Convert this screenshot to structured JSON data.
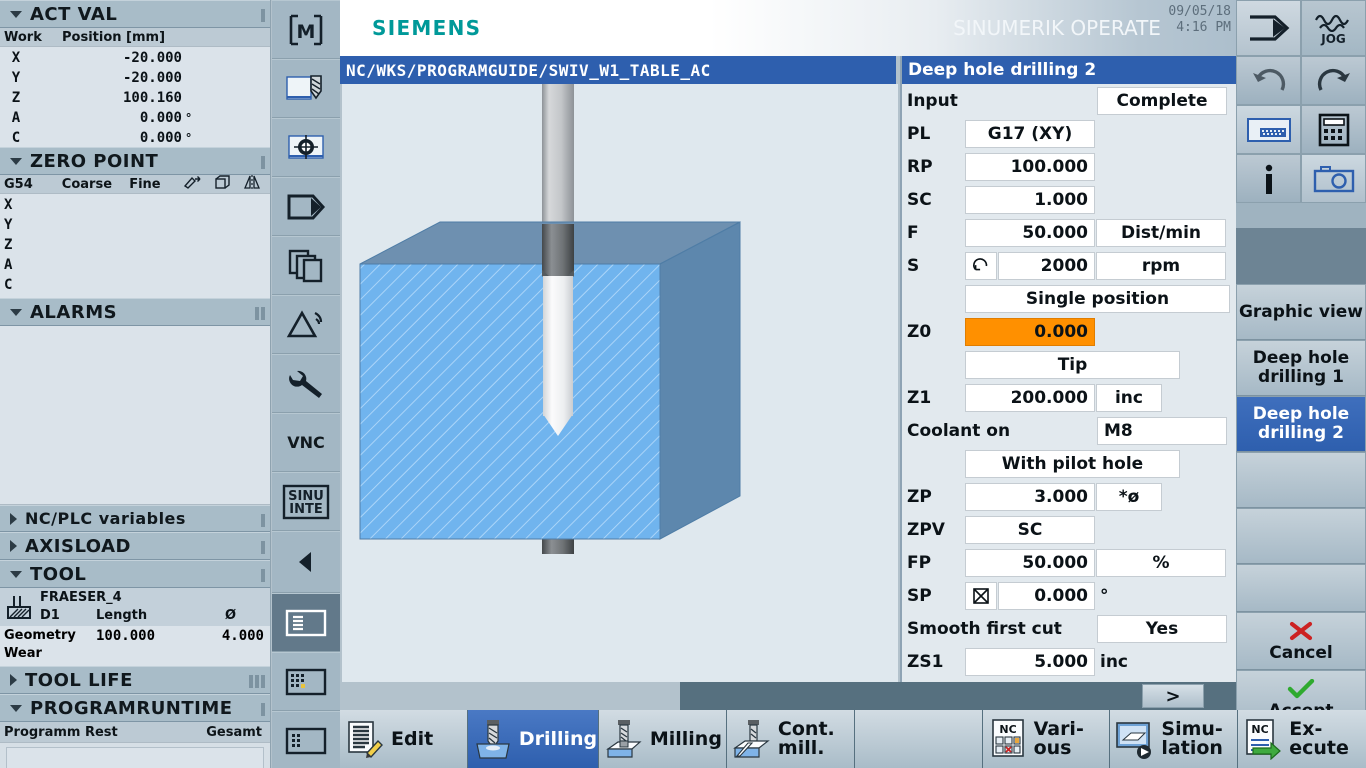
{
  "header": {
    "brand": "SIEMENS",
    "product": "SINUMERIK OPERATE",
    "date": "09/05/18",
    "time": "4:16 PM",
    "mode_label": "JOG",
    "path": "NC/WKS/PROGRAMGUIDE/SWIV_W1_TABLE_AC"
  },
  "left_panels": {
    "act_val": {
      "title": "ACT VAL",
      "col_work": "Work",
      "col_position": "Position [mm]",
      "axes": [
        {
          "name": "X",
          "value": "-20.000",
          "unit": ""
        },
        {
          "name": "Y",
          "value": "-20.000",
          "unit": ""
        },
        {
          "name": "Z",
          "value": "100.160",
          "unit": ""
        },
        {
          "name": "A",
          "value": "0.000",
          "unit": "°"
        },
        {
          "name": "C",
          "value": "0.000",
          "unit": "°"
        }
      ]
    },
    "zero_point": {
      "title": "ZERO POINT",
      "col_g54": "G54",
      "col_coarse": "Coarse",
      "col_fine": "Fine",
      "axes": [
        "X",
        "Y",
        "Z",
        "A",
        "C"
      ]
    },
    "alarms": {
      "title": "ALARMS"
    },
    "nc_plc": {
      "title": "NC/PLC variables"
    },
    "axisload": {
      "title": "AXISLOAD"
    },
    "tool": {
      "title": "TOOL",
      "tool_name": "FRAESER_4",
      "edge": "D1",
      "col_length": "Length",
      "col_dia": "Ø",
      "row_geometry": "Geometry",
      "geometry_length": "100.000",
      "geometry_dia": "4.000",
      "row_wear": "Wear"
    },
    "tool_life": {
      "title": "TOOL LIFE"
    },
    "program_runtime": {
      "title": "PROGRAMRUNTIME",
      "label_rest": "Programm Rest",
      "label_total": "Gesamt"
    }
  },
  "icon_strip": [
    {
      "name": "machine-icon",
      "glyph": "M"
    },
    {
      "name": "program-tool-icon",
      "glyph": ""
    },
    {
      "name": "program-position-icon",
      "glyph": ""
    },
    {
      "name": "program-manager-icon",
      "glyph": ""
    },
    {
      "name": "copy-pages-icon",
      "glyph": ""
    },
    {
      "name": "alarm-icon",
      "glyph": ""
    },
    {
      "name": "wrench-setup-icon",
      "glyph": ""
    },
    {
      "name": "vnc-icon",
      "glyph": "VNC"
    },
    {
      "name": "sinumerik-integrate-icon",
      "glyph": "SINU INTE"
    },
    {
      "name": "back-arrow-icon",
      "glyph": "◀"
    },
    {
      "name": "screen-list-icon",
      "glyph": ""
    },
    {
      "name": "keyboard-panel-icon",
      "glyph": ""
    },
    {
      "name": "grid-panel-icon",
      "glyph": ""
    }
  ],
  "param_panel": {
    "title": "Deep hole drilling 2",
    "rows": [
      {
        "label": "Input",
        "value": "",
        "value2": "Complete",
        "unit": "",
        "kind": "label_right"
      },
      {
        "label": "PL",
        "value": "G17 (XY)",
        "value2": "",
        "unit": "",
        "kind": "center"
      },
      {
        "label": "RP",
        "value": "100.000",
        "value2": "",
        "unit": "",
        "kind": "num"
      },
      {
        "label": "SC",
        "value": "1.000",
        "value2": "",
        "unit": "",
        "kind": "num"
      },
      {
        "label": "F",
        "value": "50.000",
        "value2": "",
        "unit": "Dist/min",
        "kind": "num_unitbox"
      },
      {
        "label": "S",
        "value": "2000",
        "value2": "",
        "unit": "rpm",
        "kind": "spindle"
      },
      {
        "label": "",
        "value": "Single position",
        "value2": "",
        "unit": "",
        "kind": "wide"
      },
      {
        "label": "Z0",
        "value": "0.000",
        "value2": "",
        "unit": "",
        "kind": "num_selected"
      },
      {
        "label": "",
        "value": "Tip",
        "value2": "",
        "unit": "",
        "kind": "wide"
      },
      {
        "label": "Z1",
        "value": "200.000",
        "value2": "",
        "unit": "inc",
        "kind": "num_unitbox"
      },
      {
        "label": "Coolant on",
        "value": "",
        "value2": "M8",
        "unit": "",
        "kind": "label_right_left"
      },
      {
        "label": "",
        "value": "With pilot hole",
        "value2": "",
        "unit": "",
        "kind": "wide"
      },
      {
        "label": "ZP",
        "value": "3.000",
        "value2": "",
        "unit": "*ø",
        "kind": "num_unitbox"
      },
      {
        "label": "ZPV",
        "value": "SC",
        "value2": "",
        "unit": "",
        "kind": "center"
      },
      {
        "label": "FP",
        "value": "50.000",
        "value2": "",
        "unit": "%",
        "kind": "num_unitbox"
      },
      {
        "label": "SP",
        "value": "0.000",
        "value2": "",
        "unit": "°",
        "kind": "checkbox_num"
      },
      {
        "label": "Smooth first cut",
        "value": "",
        "value2": "Yes",
        "unit": "",
        "kind": "label_right"
      },
      {
        "label": "ZS1",
        "value": "5.000",
        "value2": "",
        "unit": "inc",
        "kind": "num_plainunit"
      }
    ]
  },
  "right_column": {
    "mode_button": "JOG",
    "icon_buttons": [
      {
        "name": "undo-icon"
      },
      {
        "name": "redo-icon"
      },
      {
        "name": "keyboard-icon"
      },
      {
        "name": "calculator-icon"
      },
      {
        "name": "info-icon"
      },
      {
        "name": "camera-icon"
      }
    ],
    "softkeys": [
      {
        "label": "Graphic view",
        "active": false
      },
      {
        "label": "Deep hole drilling 1",
        "active": false
      },
      {
        "label": "Deep hole drilling 2",
        "active": true
      },
      {
        "label": "",
        "active": false
      },
      {
        "label": "",
        "active": false
      },
      {
        "label": "",
        "active": false
      }
    ],
    "cancel_label": "Cancel",
    "accept_label": "Accept",
    "forward_label": ">"
  },
  "bottom_bar": {
    "keys": [
      {
        "label": "Edit",
        "icon": "edit-icon",
        "active": false
      },
      {
        "label": "Drilling",
        "icon": "drilling-icon",
        "active": true
      },
      {
        "label": "Milling",
        "icon": "milling-icon",
        "active": false
      },
      {
        "label": "Cont. mill.",
        "icon": "contour-mill-icon",
        "active": false
      },
      {
        "label": "",
        "icon": "",
        "active": false
      },
      {
        "label": "Vari- ous",
        "icon": "various-nc-icon",
        "active": false
      },
      {
        "label": "Simu- lation",
        "icon": "simulation-icon",
        "active": false
      },
      {
        "label": "Ex- ecute",
        "icon": "execute-nc-icon",
        "active": false
      }
    ]
  },
  "colors": {
    "accent_blue": "#2e5fae",
    "selected_orange": "#ff9000",
    "siemens_teal": "#009999",
    "panel_bg": "#dbe3ea",
    "header_bg": "#a8bcc8",
    "workpiece_blue": "#70b4ee"
  }
}
